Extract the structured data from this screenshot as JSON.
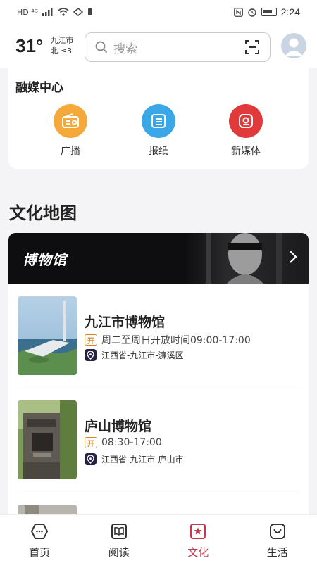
{
  "status_bar": {
    "left_glyph": "HD ⁴ᴳ",
    "time": "2:24"
  },
  "header": {
    "temperature": "31°",
    "city": "九江市",
    "wind": "北 ≤3",
    "search_placeholder": "搜索"
  },
  "media_center": {
    "title": "融媒中心",
    "items": [
      {
        "label": "广播",
        "icon": "radio-icon",
        "color": "#f5a93a"
      },
      {
        "label": "报纸",
        "icon": "newspaper-icon",
        "color": "#3aa7e8"
      },
      {
        "label": "新媒体",
        "icon": "new-media-icon",
        "color": "#e03a3a"
      }
    ]
  },
  "culture_map": {
    "title": "文化地图",
    "banner_title": "博物馆",
    "museums": [
      {
        "name": "九江市博物馆",
        "badge": "开",
        "hours": "周二至周日开放时间09:00-17:00",
        "address": "江西省-九江市-濂溪区"
      },
      {
        "name": "庐山博物馆",
        "badge": "开",
        "hours": "08:30-17:00",
        "address": "江西省-九江市-庐山市"
      }
    ]
  },
  "tab_bar": {
    "tabs": [
      {
        "label": "首页",
        "icon": "home-icon"
      },
      {
        "label": "阅读",
        "icon": "book-icon"
      },
      {
        "label": "文化",
        "icon": "culture-icon",
        "active": true
      },
      {
        "label": "生活",
        "icon": "life-icon"
      }
    ]
  },
  "colors": {
    "accent": "#c8364a",
    "open_badge": "#d9822b",
    "pin_badge": "#262341"
  }
}
